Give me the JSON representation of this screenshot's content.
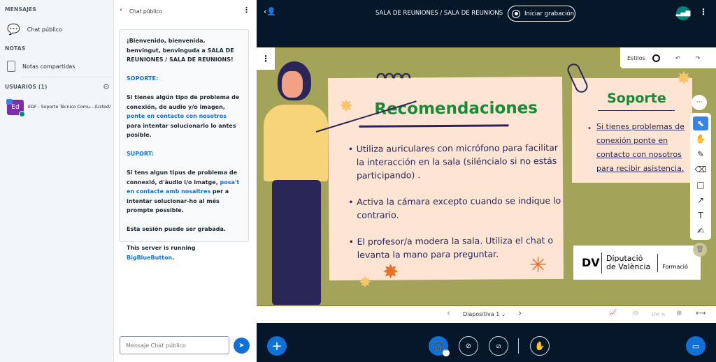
{
  "left": {
    "messages_heading": "MENSAJES",
    "public_chat": "Chat público",
    "notes_heading": "NOTAS",
    "shared_notes": "Notas compartidas",
    "users_heading": "USUARIOS (1)",
    "user": {
      "initials": "Ed",
      "name": "EDF - Soporte Técnico Comu…",
      "you": "(Usted)"
    }
  },
  "chat": {
    "title": "Chat público",
    "input_placeholder": "Mensaje Chat público",
    "welcome": {
      "p1a": "¡Bienvenido, bienvenida, benvingut, benvinguda a ",
      "p1b": "SALA DE REUNIONES / SALA DE REUNIONS",
      "p1c": "!",
      "h1": "SOPORTE:",
      "p2a": "Si tienes algún tipo de problema de conexión, de audio y/o imagen, ",
      "p2link": "ponte en contacto con nosotros",
      "p2b": " para intentar solucionarlo lo antes posible.",
      "h2": "SUPORT:",
      "p3a": "Si tens algun tipus de problema de connexió, d'àudio i/o imatge, ",
      "p3link": "posa't en contacte amb nosaltres",
      "p3b": " per a intentar solucionar-ho al més prompte possible.",
      "p4": "Esta sesión puede ser grabada.",
      "p5a": "This server is running ",
      "p5link": "BigBlueButton",
      "p5b": "."
    }
  },
  "header": {
    "title": "SALA DE REUNIONES / SALA DE REUNIONS",
    "record": "Iniciar grabación"
  },
  "whiteboard": {
    "styles": "Estilos",
    "tools": [
      "select",
      "hand",
      "pencil",
      "eraser",
      "rectangle",
      "arrow",
      "text",
      "sticky-note"
    ],
    "active_tool": "select"
  },
  "slide": {
    "heading": "Recomendaciones",
    "bullets": [
      "Utiliza auriculares con micrófono para facilitar la interacción en la sala (siléncialo si no estás participando) .",
      "Activa la cámara excepto cuando se indique lo contrario.",
      "El profesor/a modera la sala. Utiliza el chat o levanta la mano para preguntar."
    ],
    "support_heading": "Soporte",
    "support_text": "Si tienes problemas de conexión ponte en contacto con nosotros para recibir asistencia.",
    "logo": {
      "mark": "DV",
      "line1": "Diputació",
      "line2": "de València",
      "unit": "Formació"
    }
  },
  "slidebar": {
    "slide_label": "Diapositiva 1",
    "zoom": "100 %"
  },
  "colors": {
    "accent": "#0f70d7",
    "dark": "#06172a",
    "slide_bg": "#a4a35a",
    "card": "#fde4d3",
    "heading_green": "#1a8a3a",
    "teal": "#00857a"
  }
}
